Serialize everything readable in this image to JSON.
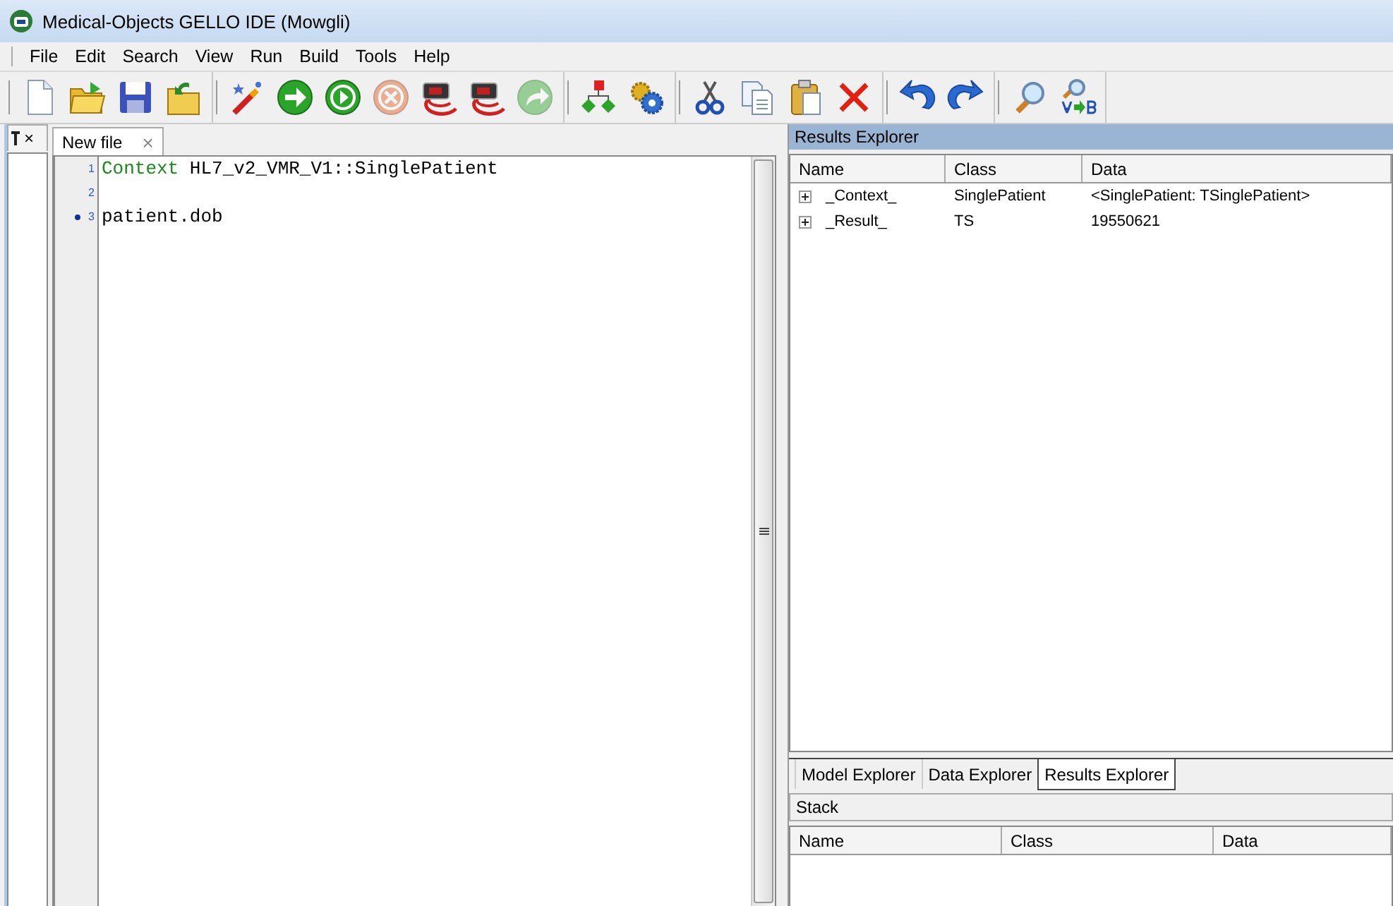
{
  "window": {
    "title": "Medical-Objects GELLO IDE (Mowgli)"
  },
  "menu": [
    "File",
    "Edit",
    "Search",
    "View",
    "Run",
    "Build",
    "Tools",
    "Help"
  ],
  "toolbar": [
    [
      {
        "kind": "new",
        "disabled": false
      },
      {
        "kind": "open",
        "disabled": false
      },
      {
        "kind": "save",
        "disabled": false
      },
      {
        "kind": "revert",
        "disabled": false
      }
    ],
    [
      {
        "kind": "wand",
        "disabled": false
      },
      {
        "kind": "go",
        "disabled": false
      },
      {
        "kind": "play",
        "disabled": false
      },
      {
        "kind": "stop",
        "disabled": true
      },
      {
        "kind": "device",
        "disabled": false
      },
      {
        "kind": "device",
        "disabled": false
      },
      {
        "kind": "forward",
        "disabled": true
      }
    ],
    [
      {
        "kind": "tree",
        "disabled": false
      },
      {
        "kind": "gears",
        "disabled": false
      }
    ],
    [
      {
        "kind": "cut",
        "disabled": false
      },
      {
        "kind": "copy",
        "disabled": false
      },
      {
        "kind": "paste",
        "disabled": false
      },
      {
        "kind": "delete",
        "disabled": false
      }
    ],
    [
      {
        "kind": "undo",
        "disabled": false
      },
      {
        "kind": "redo",
        "disabled": false
      }
    ],
    [
      {
        "kind": "find",
        "disabled": false
      },
      {
        "kind": "replace",
        "disabled": false
      }
    ]
  ],
  "side_panel": {
    "close": "×"
  },
  "editor": {
    "tabs": [
      {
        "label": "New file",
        "selected": true,
        "close": "×"
      }
    ],
    "lines": [
      {
        "number": "1",
        "marked": false,
        "segments": [
          {
            "text": "Context",
            "kind": "keyword"
          },
          {
            "text": " HL7_v2_VMR_V1::SinglePatient",
            "kind": "plain"
          }
        ]
      },
      {
        "number": "2",
        "marked": false
      },
      {
        "number": "3",
        "marked": true,
        "segments": [
          {
            "text": "patient.dob",
            "kind": "plain"
          }
        ]
      }
    ]
  },
  "results": {
    "title": "Results Explorer",
    "columns": [
      "Name",
      "Class",
      "Data"
    ],
    "rows": [
      {
        "name": "_Context_",
        "class": "SinglePatient",
        "data": "<SinglePatient: TSinglePatient>",
        "expanded": false
      },
      {
        "name": "_Result_",
        "class": "TS",
        "data": "19550621",
        "expanded": false
      }
    ]
  },
  "explorer_tabs": [
    {
      "label": "Model Explorer",
      "selected": false
    },
    {
      "label": "Data Explorer",
      "selected": false
    },
    {
      "label": "Results Explorer",
      "selected": true
    }
  ],
  "stack": {
    "title": "Stack",
    "columns": [
      "Name",
      "Class",
      "Data"
    ]
  }
}
